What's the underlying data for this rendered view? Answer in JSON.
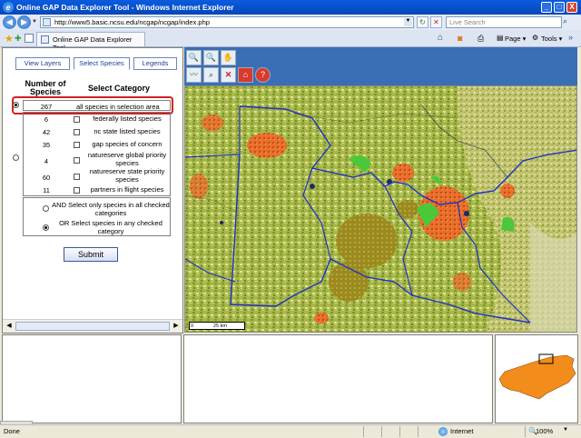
{
  "window": {
    "title": "Online GAP Data Explorer Tool - Windows Internet Explorer",
    "minimize": "_",
    "maximize": "□",
    "close": "X"
  },
  "address_bar": {
    "url": "http://www5.basic.ncsu.edu/ncgap/ncgap/index.php",
    "search_placeholder": "Live Search"
  },
  "tab_bar": {
    "tab_title": "Online GAP Data Explorer Tool",
    "page_menu": "Page",
    "tools_menu": "Tools"
  },
  "left_panel": {
    "tabs": [
      "View Layers",
      "Select Species",
      "Legends"
    ],
    "active_tab": "Select Species",
    "header_number": "Number of Species",
    "header_category": "Select Category",
    "all_species": {
      "count": "267",
      "label": "all species in selection area",
      "selected": true
    },
    "categories": [
      {
        "count": "6",
        "label": "federally listed species",
        "checked": false
      },
      {
        "count": "42",
        "label": "nc state listed species",
        "checked": false
      },
      {
        "count": "35",
        "label": "gap species of concern",
        "checked": false
      },
      {
        "count": "4",
        "label": "natureserve global priority species",
        "checked": false
      },
      {
        "count": "60",
        "label": "natureserve state priority species",
        "checked": false
      },
      {
        "count": "11",
        "label": "partners in flight species",
        "checked": false
      }
    ],
    "category_radio_selected": false,
    "operators": [
      {
        "label": "AND Select only species in all checked categories",
        "selected": false
      },
      {
        "label": "OR Select species in any checked category",
        "selected": true
      }
    ],
    "submit_label": "Submit"
  },
  "map": {
    "scale_start": "0",
    "scale_end": "25 km"
  },
  "status_bar": {
    "status": "Done",
    "zone": "Internet",
    "zoom": "100%"
  },
  "colors": {
    "toolbar_blue": "#3a6eb5",
    "highlight_red": "#d32020",
    "county_boundary": "#2030c8",
    "overview_state": "#f28c1a"
  }
}
